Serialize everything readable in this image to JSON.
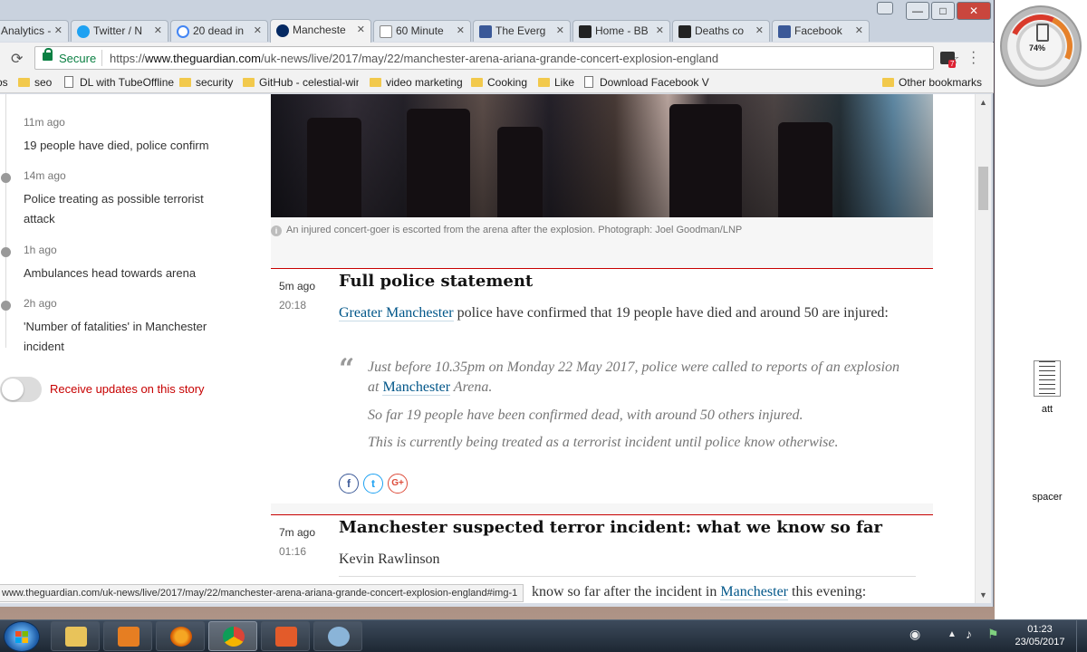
{
  "browser": {
    "tabs": [
      {
        "label": "Analytics -",
        "favicon_color": "#e37400"
      },
      {
        "label": "Twitter / N",
        "favicon_color": "#1da1f2"
      },
      {
        "label": "20 dead in",
        "favicon_color": "#4285f4"
      },
      {
        "label": "Mancheste",
        "favicon_color": "#052962"
      },
      {
        "label": "60 Minute",
        "favicon_color": "#f2f2f2"
      },
      {
        "label": "The Everg",
        "favicon_color": "#3b5998"
      },
      {
        "label": "Home - BB",
        "favicon_color": "#222222"
      },
      {
        "label": "Deaths co",
        "favicon_color": "#222222"
      },
      {
        "label": "Facebook",
        "favicon_color": "#3b5998"
      }
    ],
    "window_controls": {
      "minimize": "—",
      "maximize": "□",
      "close": "✕"
    },
    "secure_label": "Secure",
    "url_prefix": "https://",
    "url_host": "www.theguardian.com",
    "url_path": "/uk-news/live/2017/may/22/manchester-arena-ariana-grande-concert-explosion-england",
    "bookmarks": [
      "os",
      "seo",
      "DL with TubeOffline",
      "security",
      "GitHub - celestial-win",
      "video marketing",
      "Cooking",
      "Like",
      "Download Facebook V"
    ],
    "other_bookmarks": "Other bookmarks",
    "extension_badge": "7",
    "status_url": "www.theguardian.com/uk-news/live/2017/may/22/manchester-arena-ariana-grande-concert-explosion-england#img-1"
  },
  "sidebar": {
    "timeline": [
      {
        "time": "11m ago",
        "text": "19 people have died, police confirm"
      },
      {
        "time": "14m ago",
        "text": "Police treating as possible terrorist attack"
      },
      {
        "time": "1h ago",
        "text": "Ambulances head towards arena"
      },
      {
        "time": "2h ago",
        "text": "'Number of fatalities' in Manchester incident"
      }
    ],
    "updates_label": "Receive updates on this story"
  },
  "article": {
    "caption": "An injured concert-goer is escorted from the arena after the explosion. Photograph: Joel Goodman/LNP",
    "block1": {
      "time_rel": "5m ago",
      "time_abs": "20:18",
      "title": "Full police statement",
      "body_link": "Greater Manchester",
      "body_text": " police have confirmed that 19 people have died and around 50 are injured:",
      "quote_p1_a": "Just before 10.35pm on Monday 22 May 2017, police were called to reports of an explosion at ",
      "quote_p1_link": "Manchester",
      "quote_p1_b": " Arena.",
      "quote_p2": "So far 19 people have been confirmed dead, with around 50 others injured.",
      "quote_p3": "This is currently being treated as a terrorist incident until police know otherwise."
    },
    "block2": {
      "time_rel": "7m ago",
      "time_abs": "01:16",
      "title": "Manchester suspected terror incident: what we know so far",
      "author": "Kevin Rawlinson",
      "body_a": "know so far after the incident in ",
      "body_link": "Manchester",
      "body_b": " this evening:"
    }
  },
  "desktop": {
    "battery_pct": "74%",
    "icons": [
      {
        "label": "att"
      },
      {
        "label": "spacer"
      }
    ]
  },
  "taskbar": {
    "time": "01:23",
    "date": "23/05/2017"
  }
}
